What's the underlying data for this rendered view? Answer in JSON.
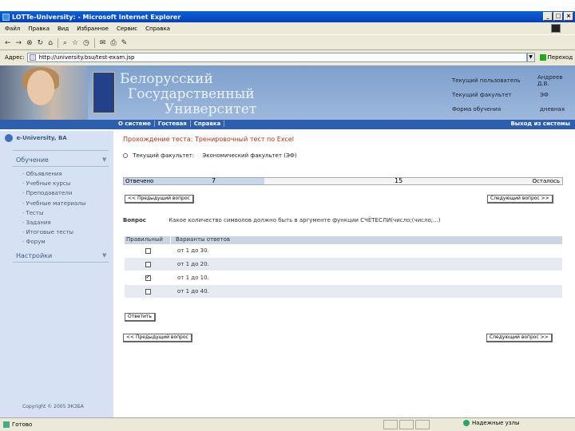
{
  "window": {
    "title": "LOTTe-University: - Microsoft Internet Explorer",
    "controls": [
      "_",
      "□",
      "×"
    ]
  },
  "menu": [
    "Файл",
    "Правка",
    "Вид",
    "Избранное",
    "Сервис",
    "Справка"
  ],
  "address": {
    "label": "Адрес:",
    "url": "http://university.bsu/test-exam.jsp",
    "go_label": "Переход"
  },
  "header": {
    "university_lines": [
      "Белорусский",
      "Государственный",
      "Университет"
    ],
    "info": [
      {
        "key": "Текущий пользователь",
        "value": "Андреев Д.В."
      },
      {
        "key": "Текущий факультет",
        "value": "ЭФ"
      },
      {
        "key": "Форма обучения",
        "value": "дневная"
      }
    ]
  },
  "nav": {
    "items": [
      "О системе",
      "Гостевая",
      "Справка"
    ],
    "logout": "Выход из системы"
  },
  "sidebar": {
    "brand": "e-University, ВА",
    "section_learning": "Обучение",
    "items": [
      "Объявления",
      "Учебные курсы",
      "Преподаватели",
      "Учебные материалы",
      "Тесты",
      "Задания",
      "Итоговые тесты",
      "Форум"
    ],
    "section_settings": "Настройки",
    "copyright": "Copyright © 2005 ЭКЗБА"
  },
  "content": {
    "title": "Прохождение теста: Тренировочный тест по Excel",
    "faculty_label": "Текущий факультет:",
    "faculty_value": "Экономический факультет (ЭФ)",
    "progress": {
      "answered_label": "Отвечено",
      "answered": "7",
      "remaining": "15",
      "remaining_label": "Осталось",
      "fraction": 0.32
    },
    "prev_button": "<< Предыдущий вопрос",
    "next_button": "Следующий вопрос >>",
    "question_label": "Вопрос",
    "question_text": "Какое количество символов должно быть в аргументе функции СЧЁТЕСЛИ(число;(число;...)",
    "answers_header": {
      "col1": "Правильный",
      "col2": "Варианты ответов"
    },
    "answers": [
      {
        "text": "от 1 до 30.",
        "checked": false
      },
      {
        "text": "от 1 до 20.",
        "checked": false
      },
      {
        "text": "от 1 до 10.",
        "checked": true
      },
      {
        "text": "от 1 до 40.",
        "checked": false
      }
    ],
    "answer_button": "Ответить"
  },
  "status": {
    "left": "Готово",
    "zone": "Надежные узлы"
  }
}
